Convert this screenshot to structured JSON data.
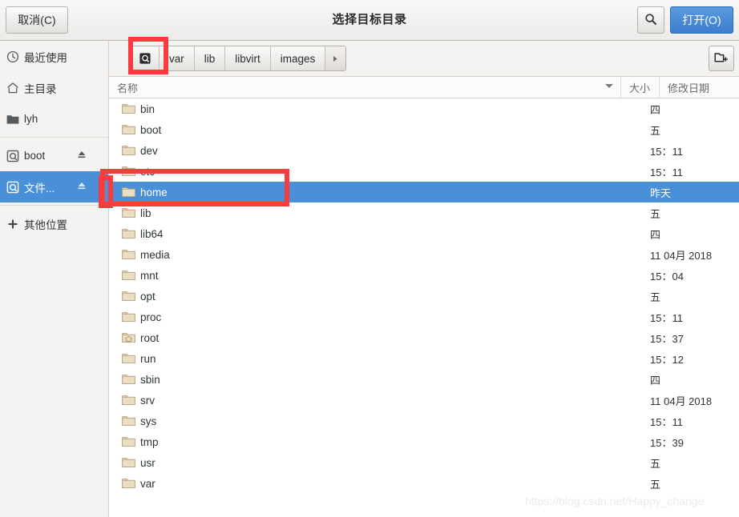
{
  "header": {
    "title": "选择目标目录",
    "cancel_label": "取消(C)",
    "open_label": "打开(O)",
    "search_icon": "search-icon"
  },
  "sidebar": {
    "items": [
      {
        "label": "最近使用",
        "icon": "clock-icon",
        "eject": false,
        "selected": false
      },
      {
        "label": "主目录",
        "icon": "home-icon",
        "eject": false,
        "selected": false
      },
      {
        "label": "lyh",
        "icon": "folder-icon",
        "eject": false,
        "selected": false
      },
      {
        "label": "boot",
        "icon": "drive-icon",
        "eject": true,
        "selected": false
      },
      {
        "label": "文件...",
        "icon": "drive-icon",
        "eject": true,
        "selected": true
      },
      {
        "label": "其他位置",
        "icon": "plus-icon",
        "eject": false,
        "selected": false
      }
    ]
  },
  "pathbar": {
    "root_icon": "drive-icon",
    "segments": [
      "var",
      "lib",
      "libvirt",
      "images"
    ],
    "next_arrow": "chevron-right-icon",
    "new_folder_label": "new-folder-icon"
  },
  "columns": {
    "name": "名称",
    "size": "大小",
    "date": "修改日期"
  },
  "files": [
    {
      "name": "bin",
      "size": "",
      "date": "四",
      "icon": "folder-icon",
      "selected": false
    },
    {
      "name": "boot",
      "size": "",
      "date": "五",
      "icon": "folder-icon",
      "selected": false
    },
    {
      "name": "dev",
      "size": "",
      "date": "15：11",
      "icon": "folder-icon",
      "selected": false
    },
    {
      "name": "etc",
      "size": "",
      "date": "15：11",
      "icon": "folder-icon",
      "selected": false
    },
    {
      "name": "home",
      "size": "",
      "date": "昨天",
      "icon": "folder-icon",
      "selected": true
    },
    {
      "name": "lib",
      "size": "",
      "date": "五",
      "icon": "folder-icon",
      "selected": false
    },
    {
      "name": "lib64",
      "size": "",
      "date": "四",
      "icon": "folder-icon",
      "selected": false
    },
    {
      "name": "media",
      "size": "",
      "date": "11 04月 2018",
      "icon": "folder-icon",
      "selected": false
    },
    {
      "name": "mnt",
      "size": "",
      "date": "15：04",
      "icon": "folder-icon",
      "selected": false
    },
    {
      "name": "opt",
      "size": "",
      "date": "五",
      "icon": "folder-icon",
      "selected": false
    },
    {
      "name": "proc",
      "size": "",
      "date": "15：11",
      "icon": "folder-icon",
      "selected": false
    },
    {
      "name": "root",
      "size": "",
      "date": "15：37",
      "icon": "home-folder-icon",
      "selected": false
    },
    {
      "name": "run",
      "size": "",
      "date": "15：12",
      "icon": "folder-icon",
      "selected": false
    },
    {
      "name": "sbin",
      "size": "",
      "date": "四",
      "icon": "folder-icon",
      "selected": false
    },
    {
      "name": "srv",
      "size": "",
      "date": "11 04月 2018",
      "icon": "folder-icon",
      "selected": false
    },
    {
      "name": "sys",
      "size": "",
      "date": "15：11",
      "icon": "folder-icon",
      "selected": false
    },
    {
      "name": "tmp",
      "size": "",
      "date": "15：39",
      "icon": "folder-icon",
      "selected": false
    },
    {
      "name": "usr",
      "size": "",
      "date": "五",
      "icon": "folder-icon",
      "selected": false
    },
    {
      "name": "var",
      "size": "",
      "date": "五",
      "icon": "folder-icon",
      "selected": false
    }
  ],
  "watermark": "https://blog.csdn.net/Happy_change",
  "colors": {
    "selection": "#4a90d9",
    "annotation": "#fa3c3c",
    "open_button": "#3c7dce"
  }
}
